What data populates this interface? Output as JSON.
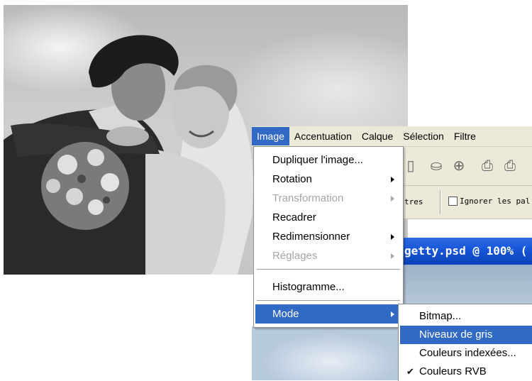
{
  "menubar": {
    "items": [
      "Image",
      "Accentuation",
      "Calque",
      "Sélection",
      "Filtre"
    ]
  },
  "toolbar": {
    "icons": [
      "stamp-icon",
      "magnify-icon",
      "printer-icon",
      "printer2-icon"
    ]
  },
  "options": {
    "partial_label": "tres",
    "checkbox_label": "Ignorer les pal"
  },
  "document": {
    "title": "getty.psd @ 100% ("
  },
  "image_menu": {
    "items": [
      {
        "label": "Dupliquer l'image...",
        "disabled": false,
        "submenu": false
      },
      {
        "label": "Rotation",
        "disabled": false,
        "submenu": true
      },
      {
        "label": "Transformation",
        "disabled": true,
        "submenu": true
      },
      {
        "label": "Recadrer",
        "disabled": false,
        "submenu": false
      },
      {
        "label": "Redimensionner",
        "disabled": false,
        "submenu": true
      },
      {
        "label": "Réglages",
        "disabled": true,
        "submenu": true
      },
      {
        "label": "Histogramme...",
        "disabled": false,
        "submenu": false
      },
      {
        "label": "Mode",
        "disabled": false,
        "submenu": true,
        "highlighted": true
      }
    ]
  },
  "mode_submenu": {
    "items": [
      {
        "label": "Bitmap...",
        "checked": false,
        "highlighted": false
      },
      {
        "label": "Niveaux de gris",
        "checked": false,
        "highlighted": true
      },
      {
        "label": "Couleurs indexées...",
        "checked": false,
        "highlighted": false
      },
      {
        "label": "Couleurs RVB",
        "checked": true,
        "highlighted": false
      }
    ]
  },
  "colors": {
    "highlight": "#316ac5",
    "menu_bg": "#ffffff",
    "bar_bg": "#ece9d8",
    "disabled_text": "#a6a6a6",
    "titlebar": "#1655d8"
  }
}
